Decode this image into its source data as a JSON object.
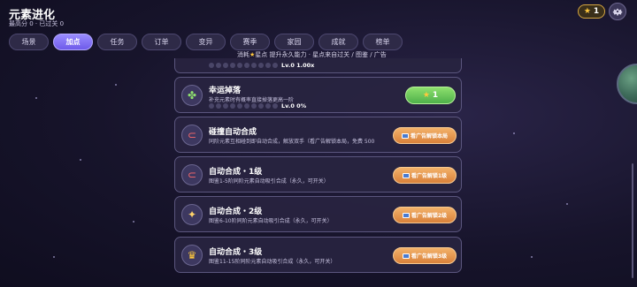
{
  "header": {
    "title": "元素进化",
    "subtitle": "最高分 0 · 已过关 0",
    "star_count": "1"
  },
  "tabs": [
    "场景",
    "加点",
    "任务",
    "订单",
    "变异",
    "赛季",
    "家园",
    "成就",
    "榜单"
  ],
  "active_tab": "加点",
  "hint": {
    "pre": "消耗",
    "star": "★",
    "post": "星点 提升永久能力 · 星点来自过关 / 图鉴 / 广告"
  },
  "upgrades": [
    {
      "name": "",
      "desc": "",
      "level": "Lv.0 1.00x",
      "icon": "partial-icon"
    },
    {
      "name": "幸运掉落",
      "desc": "补充元素时有概率直接掉落更高一阶",
      "level": "Lv.0 0%",
      "icon": "clover-icon",
      "cost": "1"
    },
    {
      "name": "碰撞自动合成",
      "desc": "同阶元素互相碰到即自动合成，解放双手（看广告解锁本局，免费 500",
      "button": "看广告解锁本局",
      "icon": "magnet-icon"
    },
    {
      "name": "自动合成・1级",
      "desc": "图鉴1-5阶同阶元素自动吸引合成（永久，可开关）",
      "button": "看广告解锁1级",
      "icon": "magnet-icon"
    },
    {
      "name": "自动合成・2级",
      "desc": "图鉴6-10阶同阶元素自动吸引合成（永久，可开关）",
      "button": "看广告解锁2级",
      "icon": "wand-icon"
    },
    {
      "name": "自动合成・3级",
      "desc": "图鉴11-15阶同阶元素自动吸引合成（永久，可开关）",
      "button": "看广告解锁3级",
      "icon": "crown-icon"
    }
  ]
}
